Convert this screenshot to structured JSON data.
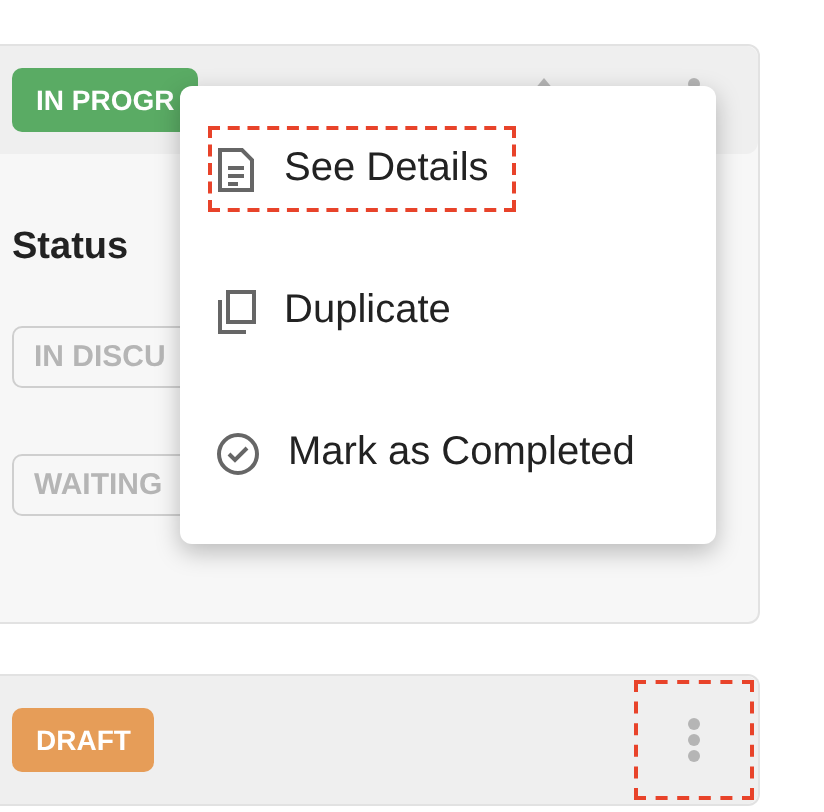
{
  "cards": [
    {
      "badge": {
        "label": "IN PROGR",
        "color": "#5aab64"
      },
      "section_title": "Status",
      "chips": [
        "IN DISCU",
        "WAITING"
      ],
      "menu_open": true,
      "more_highlighted": false
    },
    {
      "badge": {
        "label": "DRAFT",
        "color": "#e69d58"
      },
      "menu_open": false,
      "more_highlighted": true
    }
  ],
  "menu": {
    "items": [
      {
        "kind": "details",
        "label": "See Details",
        "highlighted": true
      },
      {
        "kind": "duplicate",
        "label": "Duplicate",
        "highlighted": false
      },
      {
        "kind": "complete",
        "label": "Mark as Completed",
        "highlighted": false
      }
    ]
  }
}
